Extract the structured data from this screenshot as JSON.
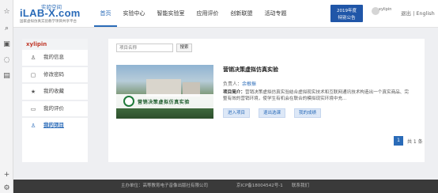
{
  "toolbar": {
    "icons": [
      "star-icon",
      "search-icon",
      "image-icon",
      "chat-icon",
      "notes-icon",
      "add-icon",
      "settings-icon"
    ]
  },
  "header": {
    "logo_cn": "实验空间",
    "logo_main": "iLAB-X.com",
    "logo_sub": "国家虚拟仿真实验教学项目共享平台",
    "nav": [
      "首页",
      "实验中心",
      "智能实验室",
      "应用评价",
      "创新联盟",
      "活动专题"
    ],
    "active_nav": "首页",
    "badge_line1": "2019年度",
    "badge_line2": "特别公告",
    "user": "xylipin",
    "logout": "退出 | English"
  },
  "sidebar": {
    "username": "xylipin",
    "items": [
      {
        "label": "我的信息",
        "icon": "user-icon"
      },
      {
        "label": "修改密码",
        "icon": "lock-icon"
      },
      {
        "label": "我的收藏",
        "icon": "star-icon"
      },
      {
        "label": "我的评价",
        "icon": "comment-icon"
      },
      {
        "label": "我的项目",
        "icon": "user-icon"
      }
    ],
    "active_item": "我的项目"
  },
  "main": {
    "search_placeholder": "项目名称",
    "search_button": "搜索",
    "project": {
      "image_text": "营销决策虚拟仿真实验",
      "title": "营销决策虚拟仿真实验",
      "owner_label": "负责人：",
      "owner": "余根振",
      "intro_label": "项目简介：",
      "intro": "营销决策虚拟仿真实验结合虚拟现实技术和互联网通讯技术构造出一个真实商品、完整有效的营销环境，使学生有机会在联合的模拟现实环境中充..."
    },
    "buttons": [
      "进入项目",
      "退出选课",
      "我的成绩"
    ],
    "pagination": {
      "current": "1",
      "total": "共 1 条"
    }
  },
  "footer": {
    "sponsor": "主办单位：高等教育电子音像出版社有限公司",
    "icp": "京ICP备18004542号-1",
    "contact": "联系我们"
  }
}
